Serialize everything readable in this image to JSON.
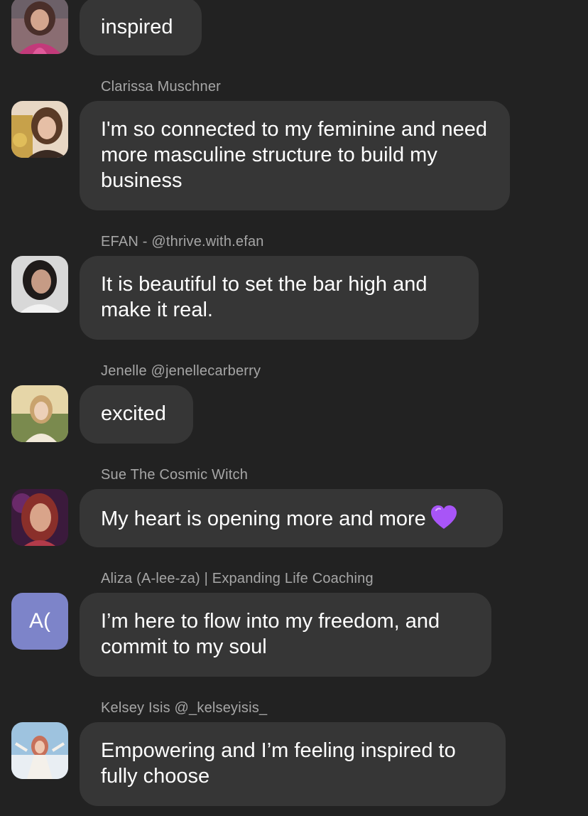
{
  "messages": [
    {
      "sender": "",
      "text": "inspired",
      "avatar": {
        "type": "photo",
        "colors": [
          "#8a6d72",
          "#c23a7a",
          "#3a2a35"
        ]
      }
    },
    {
      "sender": "Clarissa Muschner",
      "text": "I'm so connected to my feminine and need more masculine structure to build my business",
      "avatar": {
        "type": "photo",
        "colors": [
          "#c7a14a",
          "#e8d7c4",
          "#5a3a26"
        ]
      }
    },
    {
      "sender": "EFAN - @thrive.with.efan",
      "text": "It is beautiful to set the bar high and make it real.",
      "avatar": {
        "type": "photo",
        "colors": [
          "#d8d8d8",
          "#1f1b1a",
          "#c69b85"
        ]
      }
    },
    {
      "sender": "Jenelle @jenellecarberry",
      "text": "excited",
      "avatar": {
        "type": "photo",
        "colors": [
          "#e6d6a8",
          "#7a8a4e",
          "#f1e9d8"
        ]
      }
    },
    {
      "sender": "Sue The Cosmic Witch",
      "text": "My heart is opening more and more",
      "emoji": "purple-heart",
      "avatar": {
        "type": "photo",
        "colors": [
          "#3b1a3c",
          "#b23b4a",
          "#d9a48a"
        ]
      }
    },
    {
      "sender": "Aliza (A-lee-za) | Expanding Life Coaching",
      "text": "I’m here to flow into my freedom, and commit to my soul",
      "avatar": {
        "type": "initials",
        "initials": "A(",
        "color": "#7d84c9"
      }
    },
    {
      "sender": "Kelsey Isis @_kelseyisis_",
      "text": "Empowering and I’m feeling inspired to fully choose",
      "avatar": {
        "type": "photo",
        "colors": [
          "#9ec3df",
          "#f4f0ea",
          "#c7705a"
        ]
      }
    }
  ]
}
